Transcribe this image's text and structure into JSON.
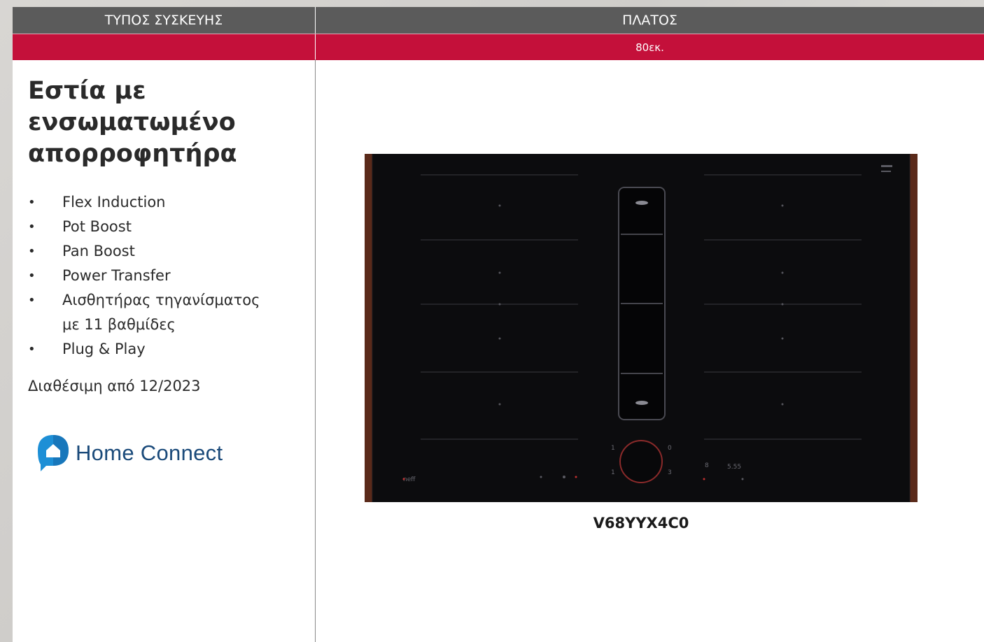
{
  "header": {
    "col_type": "ΤΥΠΟΣ ΣΥΣΚΕΥΗΣ",
    "col_width": "ΠΛΑΤΟΣ",
    "width_value": "80εκ."
  },
  "product": {
    "title": "Εστία με ενσωματωμένο απορροφητήρα",
    "features": [
      "Flex Induction",
      "Pot Boost",
      "Pan Boost",
      "Power Transfer",
      "Αισθητήρας τηγανίσματος με 11 βαθμίδες",
      "Plug & Play"
    ],
    "availability": "Διαθέσιμη από 12/2023",
    "brand_logo_text": "Home Connect",
    "model": "V68YYX4C0"
  },
  "colors": {
    "header_gray": "#5b5b5b",
    "accent_red": "#c4103a",
    "home_connect_blue": "#1a4a7a"
  },
  "icons": {
    "logo": "home-connect-icon",
    "image": "cooktop-image"
  }
}
